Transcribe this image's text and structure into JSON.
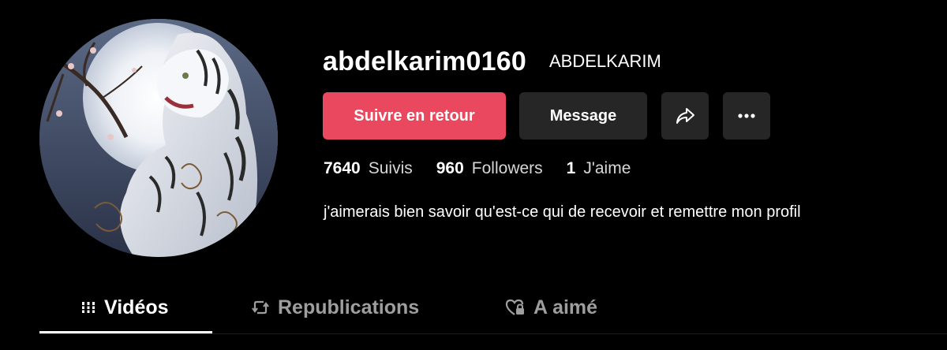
{
  "profile": {
    "username": "abdelkarim0160",
    "nickname": "ABDELKARIM",
    "avatar_icon": "tiger-moon-avatar",
    "bio": "j'aimerais bien savoir qu'est-ce qui de recevoir et remettre mon profil"
  },
  "actions": {
    "follow_back_label": "Suivre en retour",
    "message_label": "Message",
    "share_icon": "share-arrow-icon",
    "more_icon": "more-dots-icon"
  },
  "stats": {
    "following_count": "7640",
    "following_label": "Suivis",
    "followers_count": "960",
    "followers_label": "Followers",
    "likes_count": "1",
    "likes_label": "J'aime"
  },
  "tabs": [
    {
      "label": "Vidéos",
      "icon": "grid-bars-icon",
      "active": true
    },
    {
      "label": "Republications",
      "icon": "repost-icon",
      "active": false
    },
    {
      "label": "A aimé",
      "icon": "heart-lock-icon",
      "active": false
    }
  ],
  "colors": {
    "background": "#000000",
    "accent": "#e9485e",
    "button_secondary": "#262626",
    "text_muted": "#9e9e9e"
  }
}
